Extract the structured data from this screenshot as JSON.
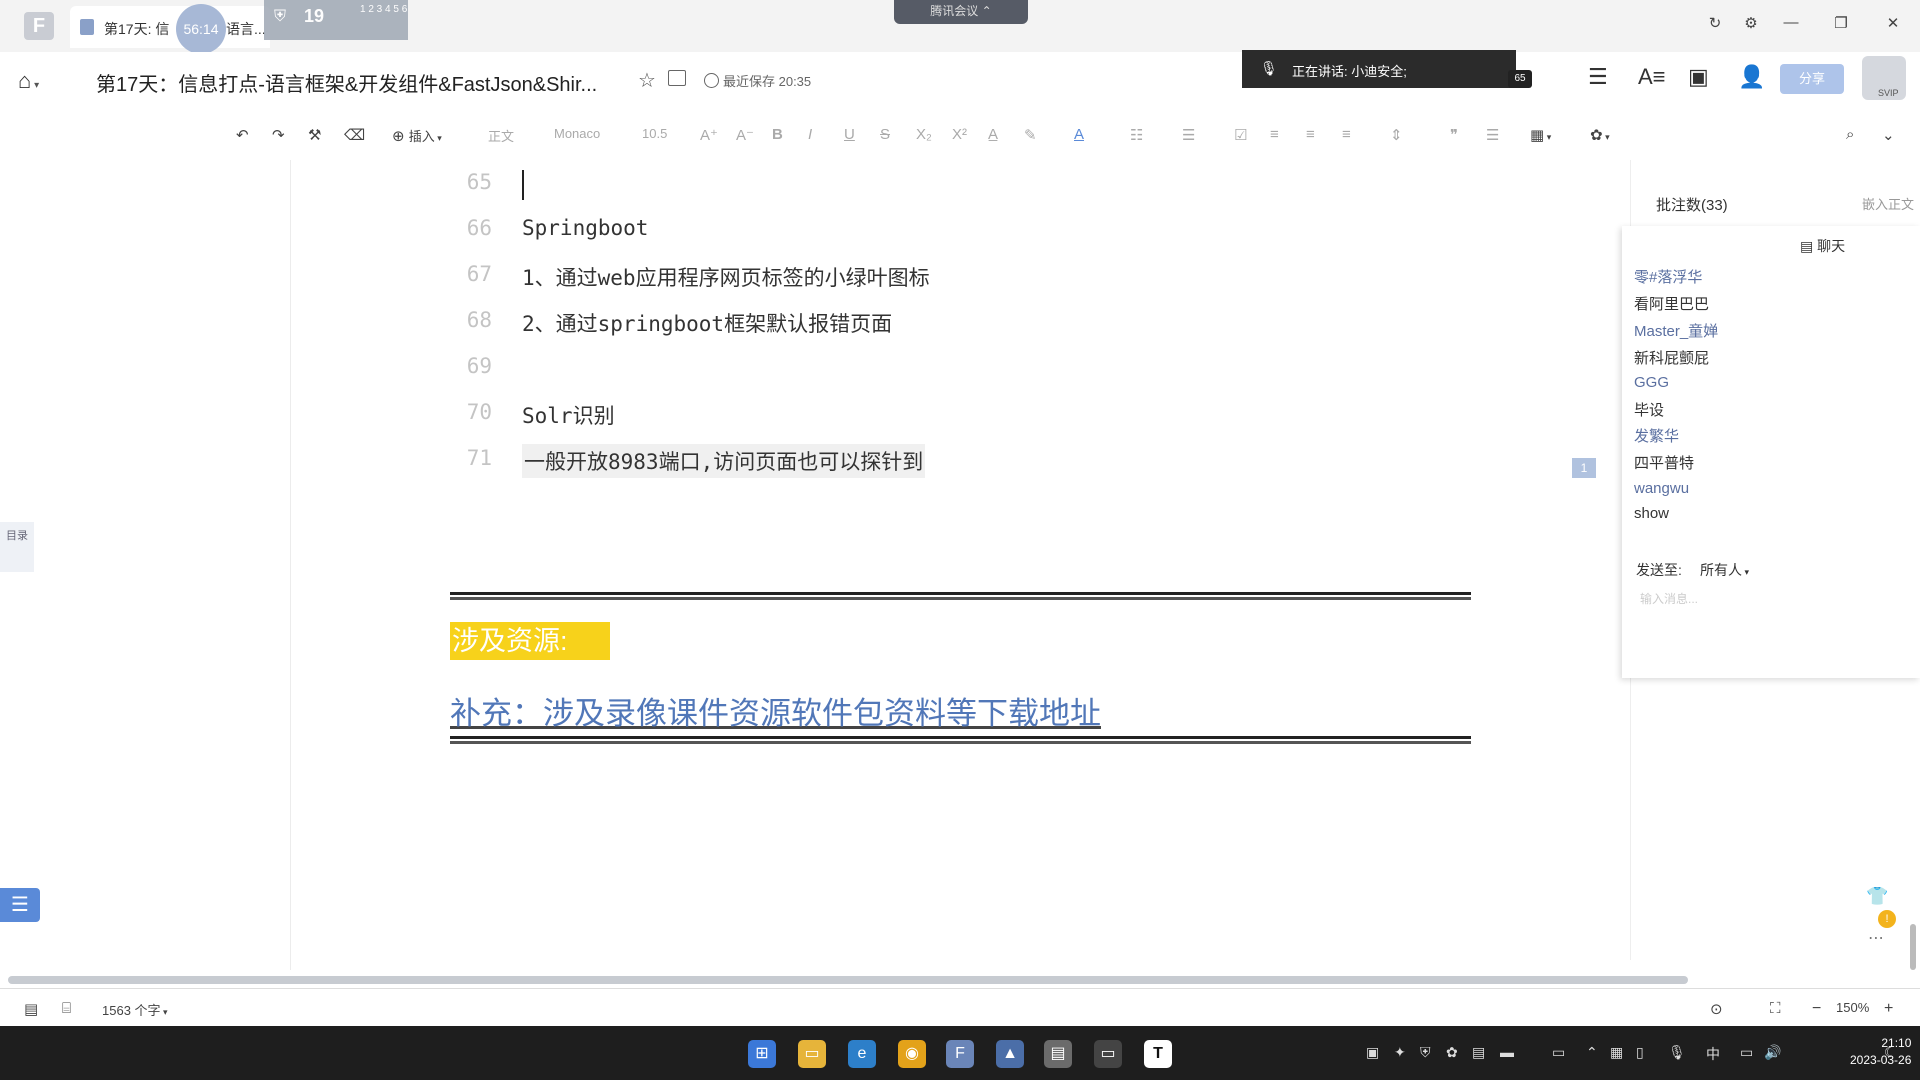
{
  "tab": {
    "title": "第17天: 信",
    "title_suffix": "语言...",
    "timer": "56:14"
  },
  "notification": {
    "count": "19",
    "sub": "1 2 3 4 5 6"
  },
  "meeting_button": "腾讯会议 ⌃",
  "doc": {
    "title": "第17天：信息打点-语言框架&开发组件&FastJson&Shir...",
    "save_status": "最近保存 20:35"
  },
  "speaking": {
    "text": "正在讲话: 小迪安全;"
  },
  "member_badge": "65",
  "share_label": "分享",
  "vip_label": "SVIP",
  "toolbar": {
    "insert": "插入",
    "style": "正文",
    "font": "Monaco",
    "size": "10.5"
  },
  "outline_label": "目录",
  "lines": [
    {
      "num": "65",
      "text": ""
    },
    {
      "num": "66",
      "text": "Springboot"
    },
    {
      "num": "67",
      "text": "1、通过web应用程序网页标签的小绿叶图标"
    },
    {
      "num": "68",
      "text": "2、通过springboot框架默认报错页面"
    },
    {
      "num": "69",
      "text": ""
    },
    {
      "num": "70",
      "text": "Solr识别"
    },
    {
      "num": "71",
      "text": "一般开放8983端口,访问页面也可以探针到"
    }
  ],
  "involved_label": "涉及资源:",
  "supplement_link": "补充：涉及录像课件资源软件包资料等下载地址",
  "comment_badge": "1",
  "comments_header": "批注数(33)",
  "embed_link": "嵌入正文",
  "chat": {
    "title": "聊天",
    "names": [
      "零#落浮华",
      "看阿里巴巴",
      "Master_童婵",
      "新科屁颤屁",
      "GGG",
      "毕设",
      "发繁华",
      "四平普特",
      "wangwu",
      "show"
    ],
    "send_to_label": "发送至:",
    "send_to_value": "所有人",
    "input_placeholder": "输入消息..."
  },
  "status": {
    "word_count": "1563 个字",
    "zoom": "150%"
  },
  "clock": {
    "time": "21:10",
    "date": "2023-03-26"
  },
  "colors": {
    "accent": "#5a8ad8",
    "highlight": "#f7d21b",
    "link": "#5177b8",
    "taskbar": "#1e1e1e"
  }
}
